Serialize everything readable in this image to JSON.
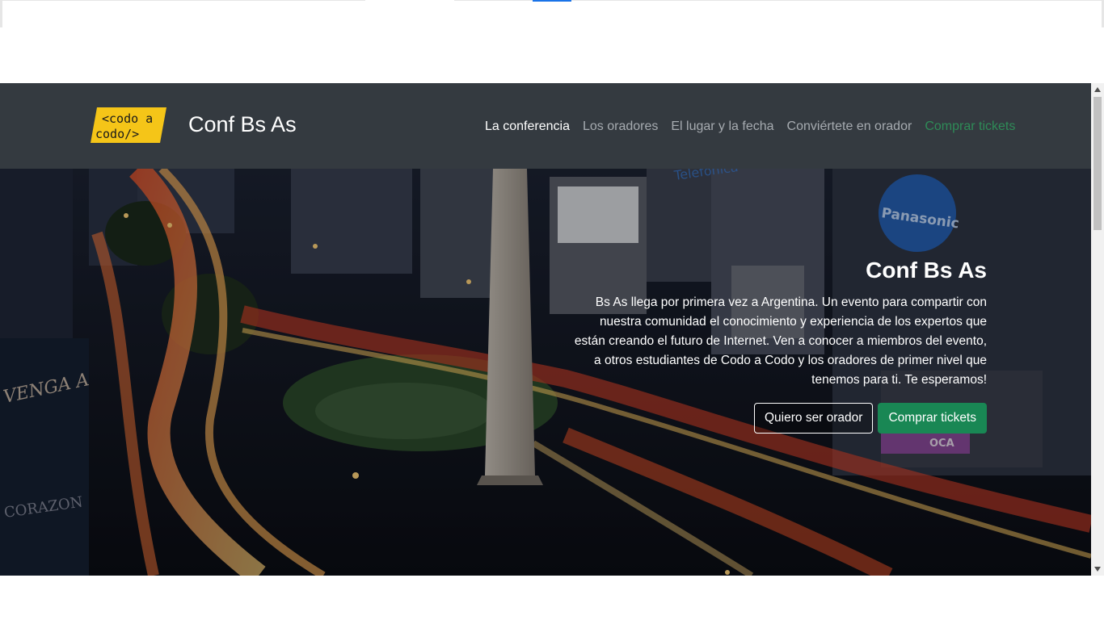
{
  "brand": {
    "logo_line1": "<codo a",
    "logo_line2": "codo/>",
    "title": "Conf Bs As"
  },
  "nav": {
    "items": [
      {
        "label": "La conferencia",
        "state": "active"
      },
      {
        "label": "Los oradores",
        "state": "normal"
      },
      {
        "label": "El lugar y la fecha",
        "state": "normal"
      },
      {
        "label": "Conviértete en orador",
        "state": "normal"
      },
      {
        "label": "Comprar tickets",
        "state": "cta"
      }
    ]
  },
  "hero": {
    "title": "Conf Bs As",
    "description": "Bs As llega por primera vez a Argentina. Un evento para compartir con nuestra comunidad el conocimiento y experiencia de los expertos que están creando el futuro de Internet. Ven a conocer a miembros del evento, a otros estudiantes de Codo a Codo y los oradores de primer nivel que tenemos para ti. Te esperamos!",
    "buttons": {
      "speaker": "Quiero ser orador",
      "tickets": "Comprar tickets"
    },
    "background_signs": {
      "left": "VENGA A",
      "left_lower": "CORAZON",
      "top": "Telefonica",
      "right": "Panasonic",
      "right_lower": "OCA"
    }
  },
  "colors": {
    "navbar_bg": "#343a40",
    "nav_link": "#a6abb0",
    "nav_active": "#ffffff",
    "nav_cta": "#2e8b57",
    "btn_success": "#198754",
    "logo_yellow": "#f5c518"
  },
  "icons": {
    "scroll_up": "chevron-up-icon",
    "scroll_down": "chevron-down-icon"
  }
}
